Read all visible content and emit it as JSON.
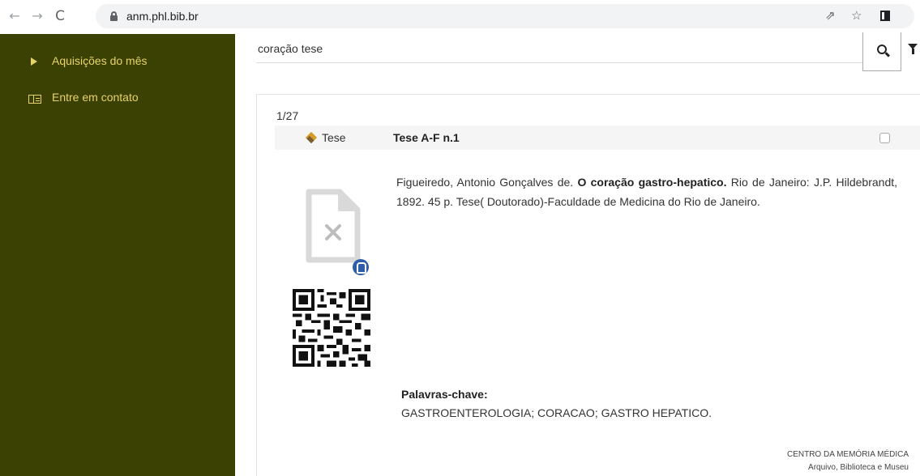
{
  "browser": {
    "url": "anm.phl.bib.br",
    "nav": {
      "back": "←",
      "forward": "→",
      "reload": "C"
    },
    "icons": {
      "share": "⇗",
      "star": "☆"
    }
  },
  "sidebar": {
    "items": [
      {
        "label": "Aquisições do mês",
        "icon": "triangle-right-icon"
      },
      {
        "label": "Entre em contato",
        "icon": "contact-card-icon"
      }
    ],
    "colors": {
      "background": "#3b4003",
      "text": "#e8d36a"
    }
  },
  "search": {
    "query": "coração tese"
  },
  "result": {
    "counter": "1/27",
    "type_label": "Tese",
    "call_number": "Tese A-F n.1",
    "citation": {
      "author": "Figueiredo, Antonio Gonçalves de.",
      "title": "O coração gastro-hepatico.",
      "imprint": "Rio de Janeiro: J.P. Hildebrandt, 1892. 45 p. Tese( Doutorado)-Faculdade de Medicina do Rio de Janeiro."
    },
    "keywords_label": "Palavras-chave:",
    "keywords": "GASTROENTEROLOGIA; CORACAO; GASTRO HEPATICO."
  },
  "footer": {
    "org_line1": "CENTRO DA MEMÓRIA MÉDICA",
    "org_line2": "Arquivo, Biblioteca e Museu"
  }
}
